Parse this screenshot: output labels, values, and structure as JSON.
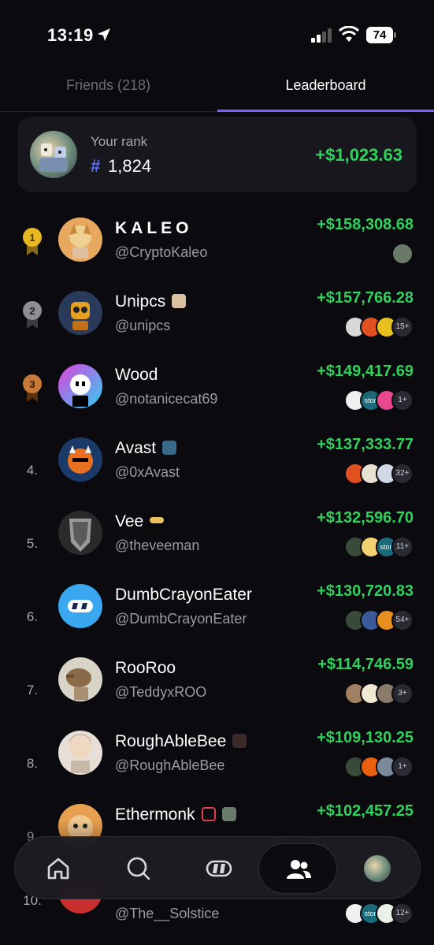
{
  "status_bar": {
    "time": "13:19",
    "battery": "74"
  },
  "tabs": [
    {
      "label": "Friends (218)",
      "active": false
    },
    {
      "label": "Leaderboard",
      "active": true
    }
  ],
  "your_rank": {
    "label": "Your rank",
    "hash": "#",
    "rank": "1,824",
    "pnl": "+$1,023.63"
  },
  "leaderboard": [
    {
      "position": "1",
      "medal": "gold",
      "name": "KALEO",
      "handle": "@CryptoKaleo",
      "pnl": "+$158,308.68",
      "more": ""
    },
    {
      "position": "2",
      "medal": "silver",
      "name": "Unipcs",
      "handle": "@unipcs",
      "pnl": "+$157,766.28",
      "more": "15+"
    },
    {
      "position": "3",
      "medal": "bronze",
      "name": "Wood",
      "handle": "@notanicecat69",
      "pnl": "+$149,417.69",
      "more": "1+"
    },
    {
      "position": "4.",
      "medal": "",
      "name": "Avast",
      "handle": "@0xAvast",
      "pnl": "+$137,333.77",
      "more": "32+"
    },
    {
      "position": "5.",
      "medal": "",
      "name": "Vee",
      "handle": "@theveeman",
      "pnl": "+$132,596.70",
      "more": "11+"
    },
    {
      "position": "6.",
      "medal": "",
      "name": "DumbCrayonEater",
      "handle": "@DumbCrayonEater",
      "pnl": "+$130,720.83",
      "more": "54+"
    },
    {
      "position": "7.",
      "medal": "",
      "name": "RooRoo",
      "handle": "@TeddyxROO",
      "pnl": "+$114,746.59",
      "more": "3+"
    },
    {
      "position": "8.",
      "medal": "",
      "name": "RoughAbleBee",
      "handle": "@RoughAbleBee",
      "pnl": "+$109,130.25",
      "more": "1+"
    },
    {
      "position": "9.",
      "medal": "",
      "name": "Ethermonk",
      "handle": "",
      "pnl": "+$102,457.25",
      "more": ""
    },
    {
      "position": "10.",
      "medal": "",
      "name": "",
      "handle": "@The__Solstice",
      "pnl": "",
      "more": "12+"
    }
  ],
  "coin_labels": {
    "ston": "ston"
  },
  "colors": {
    "accent": "#6d63ff",
    "profit": "#2fd35c",
    "background": "#0a0a0f"
  },
  "nav": [
    "home-icon",
    "search-icon",
    "swap-icon",
    "friends-icon",
    "profile-avatar"
  ]
}
